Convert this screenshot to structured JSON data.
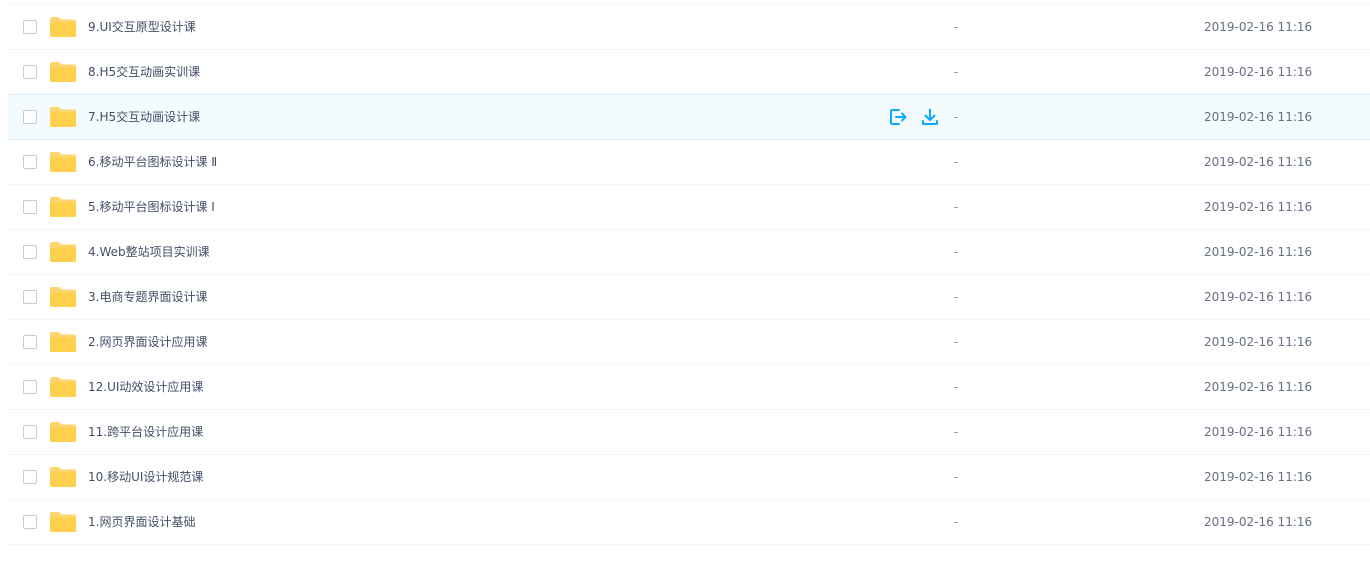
{
  "colors": {
    "folder": "#ffd66e",
    "accent": "#09aaff",
    "hover_row": "#f4fbff"
  },
  "files": [
    {
      "name": "9.UI交互原型设计课",
      "size": "-",
      "date": "2019-02-16 11:16"
    },
    {
      "name": "8.H5交互动画实训课",
      "size": "-",
      "date": "2019-02-16 11:16"
    },
    {
      "name": "7.H5交互动画设计课",
      "size": "-",
      "date": "2019-02-16 11:16"
    },
    {
      "name": "6.移动平台图标设计课 Ⅱ",
      "size": "-",
      "date": "2019-02-16 11:16"
    },
    {
      "name": "5.移动平台图标设计课 Ⅰ",
      "size": "-",
      "date": "2019-02-16 11:16"
    },
    {
      "name": "4.Web整站项目实训课",
      "size": "-",
      "date": "2019-02-16 11:16"
    },
    {
      "name": "3.电商专题界面设计课",
      "size": "-",
      "date": "2019-02-16 11:16"
    },
    {
      "name": "2.网页界面设计应用课",
      "size": "-",
      "date": "2019-02-16 11:16"
    },
    {
      "name": "12.UI动效设计应用课",
      "size": "-",
      "date": "2019-02-16 11:16"
    },
    {
      "name": "11.跨平台设计应用课",
      "size": "-",
      "date": "2019-02-16 11:16"
    },
    {
      "name": "10.移动UI设计规范课",
      "size": "-",
      "date": "2019-02-16 11:16"
    },
    {
      "name": "1.网页界面设计基础",
      "size": "-",
      "date": "2019-02-16 11:16"
    }
  ],
  "hover_row_actions": [
    "share-icon",
    "download-icon"
  ]
}
